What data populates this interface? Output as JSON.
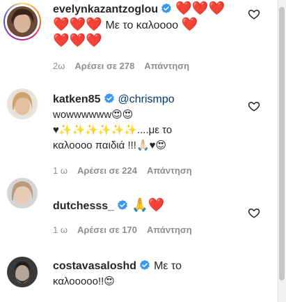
{
  "comments": [
    {
      "username": "evelynkazantzoglou",
      "line1_emoji": "❤️❤️❤️",
      "line2_pre": "❤️❤️❤️",
      "line2_text": "Με το καλοοοο",
      "line2_post": "❤️",
      "line3": "❤️❤️❤️",
      "time": "2ω",
      "likes": "Αρέσει σε 278",
      "reply": "Απάντηση"
    },
    {
      "username": "katken85",
      "mention": "@chrismpo",
      "line1": "wowwwwww😍😍",
      "line2": "♥✨✨✨✨✨✨....με το",
      "line3": "καλοοοο παιδιά !!!🙏🏻♥😍",
      "time": "1 ω",
      "likes": "Αρέσει σε 224",
      "reply": "Απάντηση"
    },
    {
      "username": "dutchesss_",
      "text": "🙏❤️",
      "time": "1 ω",
      "likes": "Αρέσει σε 170",
      "reply": "Απάντηση"
    },
    {
      "username": "costavasaloshd",
      "text_inline": "Με το",
      "line2": "καλοοοοο!!😍"
    }
  ],
  "colors": {
    "verified": "#3897f0",
    "heart": "#e0123e",
    "meta": "#8e8e8e",
    "mention": "#00376b"
  },
  "icons": {
    "like": "heart-outline-icon",
    "verified": "verified-badge-icon"
  }
}
